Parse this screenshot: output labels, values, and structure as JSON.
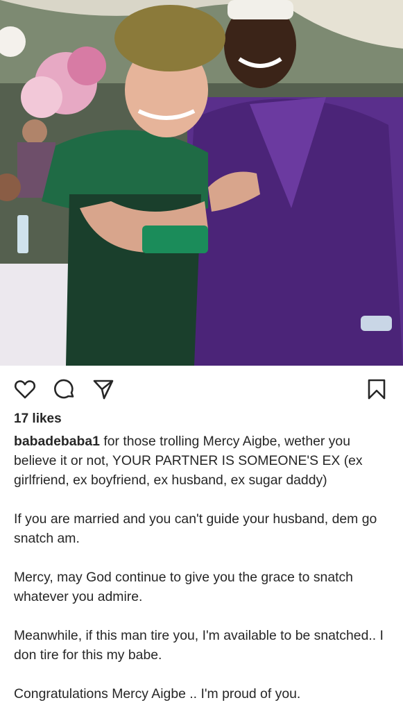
{
  "photo": {
    "alt_subject": "couple-photo"
  },
  "actions": {
    "like_icon": "heart-icon",
    "comment_icon": "comment-icon",
    "share_icon": "send-icon",
    "save_icon": "bookmark-icon"
  },
  "likes": "17 likes",
  "caption": {
    "username": "babadebaba1",
    "lines": [
      "for those trolling Mercy Aigbe, wether you believe it or not, YOUR PARTNER IS SOMEONE'S EX (ex girlfriend, ex boyfriend, ex husband, ex sugar daddy)",
      "If you are married and you can't guide your husband, dem go snatch am.",
      "Mercy, may God continue to give you the grace to snatch whatever you admire.",
      "Meanwhile, if this man tire you, I'm available to be snatched.. I don tire for this my babe.",
      "Congratulations Mercy Aigbe .. I'm proud of you."
    ]
  },
  "colors": {
    "text": "#262626",
    "background": "#ffffff"
  }
}
